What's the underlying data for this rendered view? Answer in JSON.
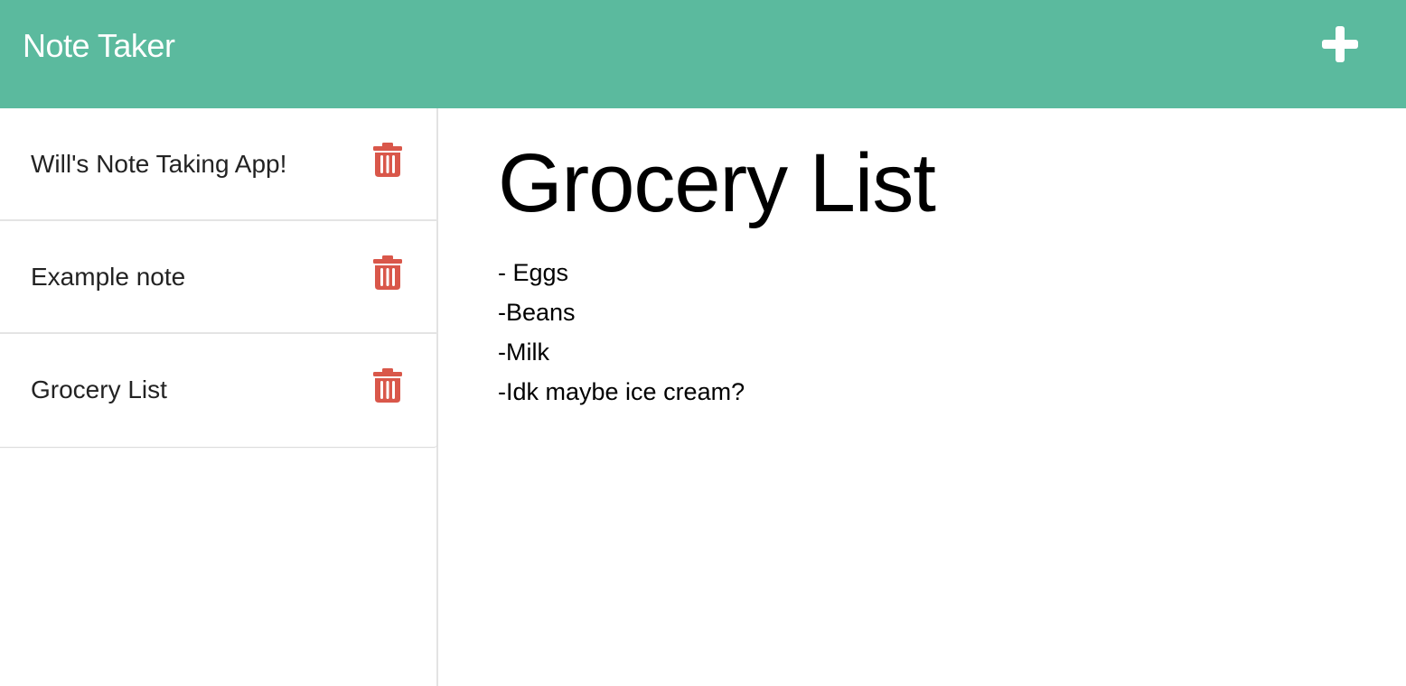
{
  "app": {
    "title": "Note Taker"
  },
  "icons": {
    "new_note": "plus-icon",
    "delete": "trash-icon"
  },
  "colors": {
    "navbar": "#5bba9e",
    "delete_icon": "#d9574a",
    "text": "#232323"
  },
  "sidebar": {
    "notes": [
      {
        "title": "Will's Note Taking App!"
      },
      {
        "title": "Example note"
      },
      {
        "title": "Grocery List"
      }
    ]
  },
  "active_note": {
    "title": "Grocery List",
    "lines": [
      "- Eggs",
      "-Beans",
      "-Milk",
      "-Idk maybe ice cream?"
    ]
  }
}
